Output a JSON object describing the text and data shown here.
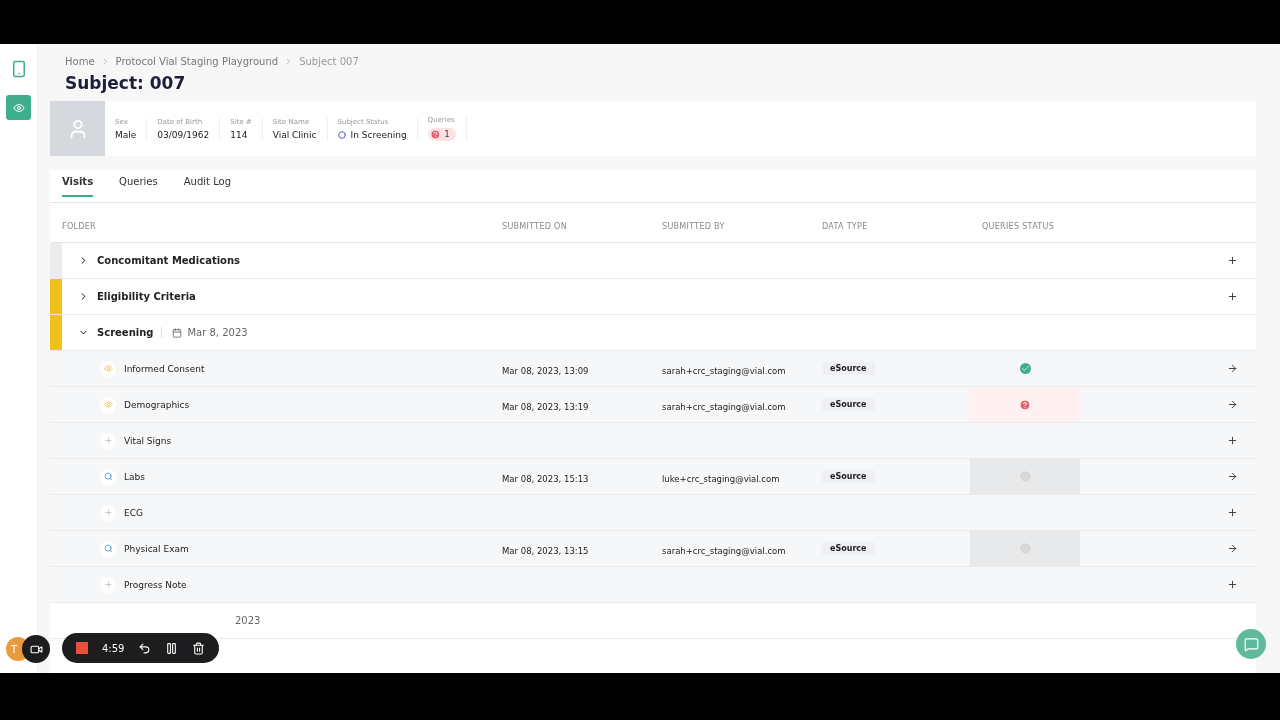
{
  "breadcrumb": [
    "Home",
    "Protocol Vial Staging Playground",
    "Subject 007"
  ],
  "title": "Subject: 007",
  "subject_fields": [
    {
      "label": "Sex",
      "value": "Male",
      "kind": "text"
    },
    {
      "label": "Date of Birth",
      "value": "03/09/1962",
      "kind": "text"
    },
    {
      "label": "Site #",
      "value": "114",
      "kind": "text"
    },
    {
      "label": "Site Name",
      "value": "Vial Clinic",
      "kind": "text"
    },
    {
      "label": "Subject Status",
      "value": "In Screening",
      "kind": "status"
    },
    {
      "label": "Queries",
      "value": "1",
      "kind": "queries"
    }
  ],
  "tabs": [
    {
      "label": "Visits",
      "selected": true
    },
    {
      "label": "Queries",
      "selected": false
    },
    {
      "label": "Audit Log",
      "selected": false
    }
  ],
  "table": {
    "columns": [
      "FOLDER",
      "SUBMITTED ON",
      "SUBMITTED BY",
      "DATA TYPE",
      "QUERIES STATUS"
    ],
    "folders": [
      {
        "name": "Concomitant Medications",
        "expanded": false,
        "flagged": false
      },
      {
        "name": "Eligibility Criteria",
        "expanded": false,
        "flagged": true
      },
      {
        "name": "Screening",
        "expanded": true,
        "flagged": true,
        "date": "Mar 8, 2023"
      }
    ],
    "forms": [
      {
        "name": "Informed Consent",
        "kind": "in-progress",
        "submitted_on": "Mar 08, 2023, 13:09",
        "submitted_by": "sarah+crc_staging@vial.com",
        "data_type": "eSource",
        "queries": {
          "kind": "ok"
        }
      },
      {
        "name": "Demographics",
        "kind": "in-progress",
        "submitted_on": "Mar 08, 2023, 13:19",
        "submitted_by": "sarah+crc_staging@vial.com",
        "data_type": "eSource",
        "queries": {
          "kind": "open"
        }
      },
      {
        "name": "Vital Signs",
        "kind": "empty"
      },
      {
        "name": "Labs",
        "kind": "review",
        "submitted_on": "Mar 08, 2023, 15:13",
        "submitted_by": "luke+crc_staging@vial.com",
        "data_type": "eSource",
        "queries": {
          "kind": "none"
        }
      },
      {
        "name": "ECG",
        "kind": "empty"
      },
      {
        "name": "Physical Exam",
        "kind": "review",
        "submitted_on": "Mar 08, 2023, 13:15",
        "submitted_by": "sarah+crc_staging@vial.com",
        "data_type": "eSource",
        "queries": {
          "kind": "none"
        }
      },
      {
        "name": "Progress Note",
        "kind": "empty"
      }
    ],
    "next_folder_date": "2023"
  },
  "recorder": {
    "time": "4:59"
  },
  "user_initial": "T"
}
